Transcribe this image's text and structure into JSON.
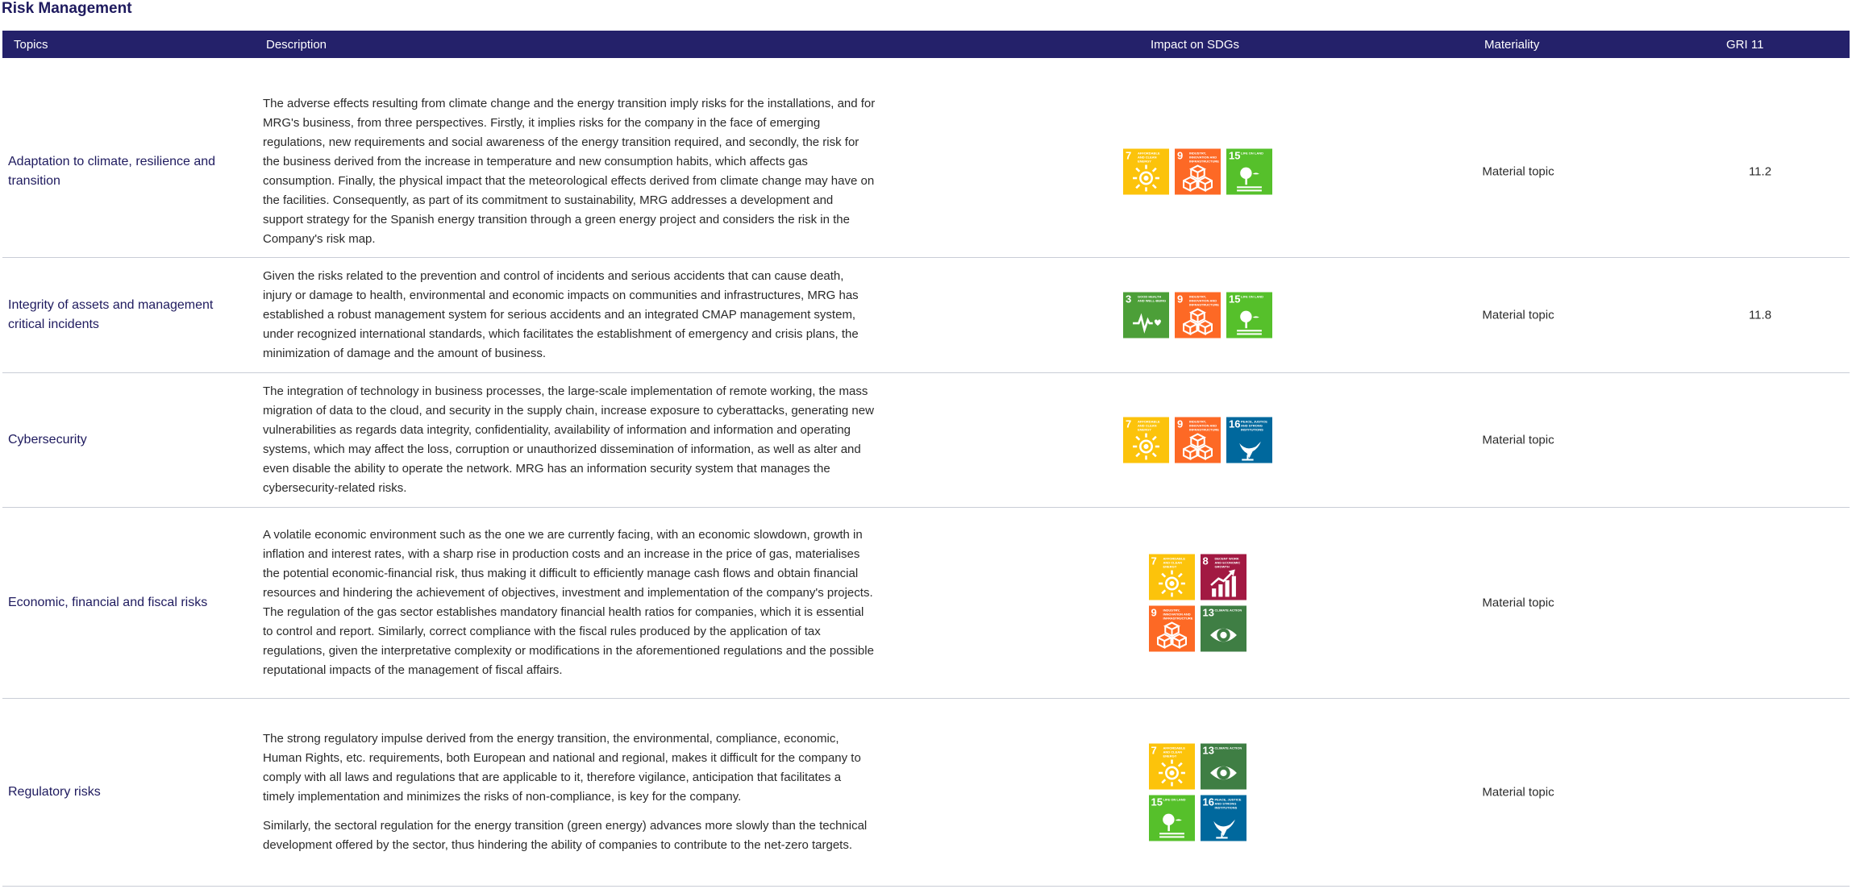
{
  "page_title": "Risk Management",
  "columns": {
    "topics": "Topics",
    "description": "Description",
    "sdgs": "Impact on SDGs",
    "materiality": "Materiality",
    "gri": "GRI 11"
  },
  "sdg_tiles": {
    "3": {
      "label": "GOOD HEALTH AND WELL-BEING",
      "color": "#4C9F38",
      "icon": "heartbeat-icon"
    },
    "7": {
      "label": "AFFORDABLE AND CLEAN ENERGY",
      "color": "#FCC30B",
      "icon": "sun-icon"
    },
    "8": {
      "label": "DECENT WORK AND ECONOMIC GROWTH",
      "color": "#A21942",
      "icon": "growth-chart-icon"
    },
    "9": {
      "label": "INDUSTRY, INNOVATION AND INFRASTRUCTURE",
      "color": "#FD6925",
      "icon": "cubes-icon"
    },
    "13": {
      "label": "CLIMATE ACTION",
      "color": "#3F7E44",
      "icon": "eye-globe-icon"
    },
    "15": {
      "label": "LIFE ON LAND",
      "color": "#56C02B",
      "icon": "tree-bird-icon"
    },
    "16": {
      "label": "PEACE, JUSTICE AND STRONG INSTITUTIONS",
      "color": "#00689D",
      "icon": "dove-icon"
    }
  },
  "rows": [
    {
      "topic": "Adaptation to climate, resilience and transition",
      "description": [
        "The adverse effects resulting from climate change and the energy transition imply risks for the installations, and for MRG's business, from three perspectives. Firstly, it implies risks for the company in the face of emerging regulations, new requirements and social awareness of the energy transition required, and secondly, the risk for the business derived from the increase in temperature and new consumption habits, which affects gas consumption. Finally, the physical impact that the meteorological effects derived from climate change may have on the facilities. Consequently, as part of its commitment to sustainability, MRG addresses a development and support strategy for the Spanish energy transition through a green energy project and considers the risk in the Company's risk map."
      ],
      "sdgs": [
        "7",
        "9",
        "15"
      ],
      "materiality": "Material topic",
      "gri": "11.2"
    },
    {
      "topic": "Integrity of assets and management critical incidents",
      "description": [
        "Given the risks related to the prevention and control of incidents and serious accidents that can cause death, injury or damage to health, environmental and economic impacts on communities and infrastructures, MRG has established a robust management system for serious accidents and an integrated CMAP management system, under recognized international standards, which facilitates the establishment of emergency and crisis plans, the minimization of damage and the amount of business."
      ],
      "sdgs": [
        "3",
        "9",
        "15"
      ],
      "materiality": "Material topic",
      "gri": "11.8"
    },
    {
      "topic": "Cybersecurity",
      "description": [
        "The integration of technology in business processes, the large-scale implementation of remote working, the mass migration of data to the cloud, and security in the supply chain, increase exposure to cyberattacks, generating new vulnerabilities as regards data integrity, confidentiality, availability of information and information and operating systems, which may affect the loss, corruption or unauthorized dissemination of information, as well as alter and even disable the ability to operate the network. MRG has an information security system that manages the cybersecurity-related risks."
      ],
      "sdgs": [
        "7",
        "9",
        "16"
      ],
      "materiality": "Material topic",
      "gri": ""
    },
    {
      "topic": "Economic, financial and fiscal risks",
      "description": [
        "A volatile economic environment such as the one we are currently facing, with an economic slowdown, growth in inflation and interest rates, with a sharp rise in production costs and an increase in the price of gas, materialises the potential economic-financial risk, thus making it difficult to efficiently manage cash flows and obtain financial resources and hindering the achievement of objectives, investment and implementation of the company's projects. The regulation of the gas sector establishes mandatory financial health ratios for companies, which it is essential to control and report. Similarly, correct compliance with the fiscal rules produced by the application of tax regulations, given the interpretative complexity or modifications in the aforementioned regulations and the possible reputational impacts of the management of fiscal affairs."
      ],
      "sdgs": [
        "7",
        "8",
        "9",
        "13"
      ],
      "materiality": "Material topic",
      "gri": ""
    },
    {
      "topic": "Regulatory risks",
      "description": [
        "The strong regulatory impulse derived from the energy transition, the environmental, compliance, economic, Human Rights, etc. requirements, both European and national and regional, makes it difficult for the company to comply with all laws and regulations that are applicable to it, therefore vigilance, anticipation that facilitates a timely implementation and minimizes the risks of non-compliance, is key for the company.",
        "Similarly, the sectoral regulation for the energy transition (green energy) advances more slowly than the technical development offered by the sector, thus hindering the ability of companies to contribute to the net-zero targets."
      ],
      "sdgs": [
        "7",
        "13",
        "15",
        "16"
      ],
      "materiality": "Material topic",
      "gri": ""
    }
  ]
}
